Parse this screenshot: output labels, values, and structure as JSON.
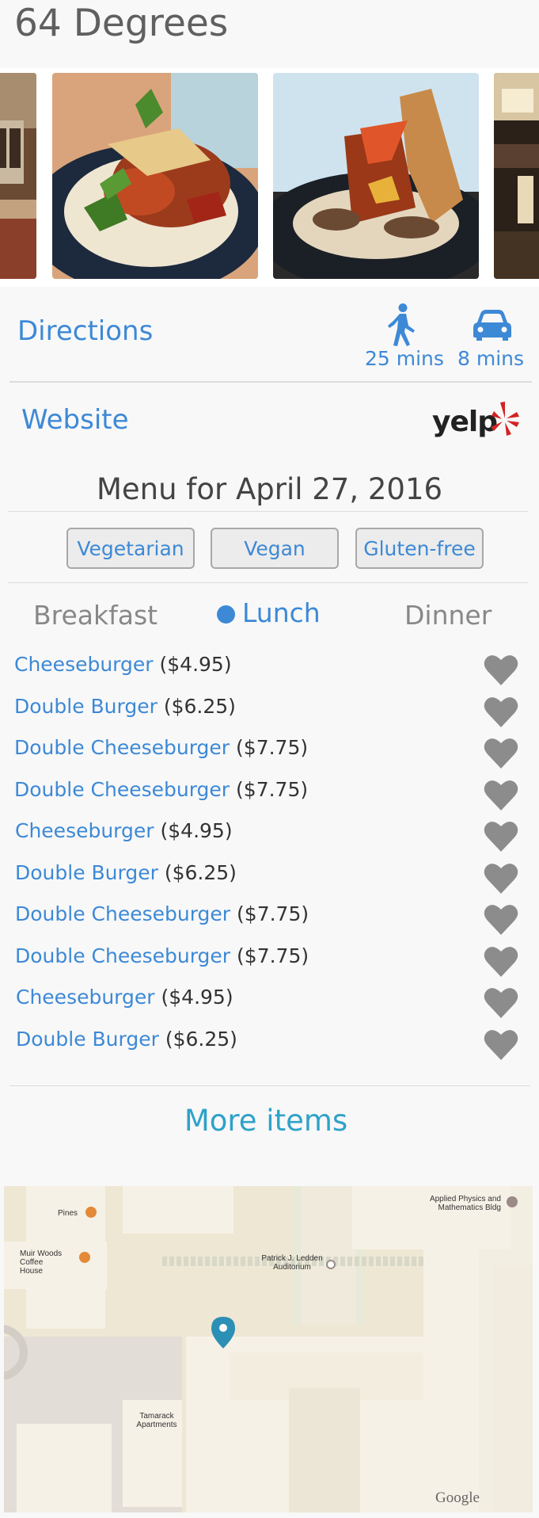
{
  "restaurant": {
    "name": "64 Degrees"
  },
  "photos": [
    {
      "name": "interior-photo-left"
    },
    {
      "name": "food-photo-1"
    },
    {
      "name": "food-photo-2"
    },
    {
      "name": "interior-photo-right"
    }
  ],
  "directions": {
    "label": "Directions",
    "walk": {
      "icon": "walk-icon",
      "time": "25 mins"
    },
    "drive": {
      "icon": "car-icon",
      "time": "8 mins"
    }
  },
  "website": {
    "label": "Website",
    "logo": "yelp",
    "logo_color": "#d32323"
  },
  "menu": {
    "heading": "Menu for April 27, 2016",
    "filters": [
      "Vegetarian",
      "Vegan",
      "Gluten-free"
    ],
    "meals": [
      "Breakfast",
      "Lunch",
      "Dinner"
    ],
    "selected_meal": "Lunch",
    "items": [
      {
        "name": "Cheeseburger",
        "price": "($4.95)"
      },
      {
        "name": "Double Burger",
        "price": "($6.25)"
      },
      {
        "name": "Double Cheeseburger",
        "price": "($7.75)"
      },
      {
        "name": "Double Cheeseburger",
        "price": "($7.75)"
      },
      {
        "name": "Cheeseburger",
        "price": "($4.95)"
      },
      {
        "name": "Double Burger",
        "price": "($6.25)"
      },
      {
        "name": "Double Cheeseburger",
        "price": "($7.75)"
      },
      {
        "name": "Double Cheeseburger",
        "price": "($7.75)"
      },
      {
        "name": "Cheeseburger",
        "price": "($4.95)"
      },
      {
        "name": "Double Burger",
        "price": "($6.25)"
      }
    ],
    "more_label": "More items"
  },
  "map": {
    "labels": {
      "pines": "Pines",
      "muir_woods": "Muir Woods Coffee House",
      "ledden": "Patrick J. Ledden Auditorium",
      "applied_physics": "Applied Physics and Mathematics Bldg",
      "tamarack": "Tamarack Apartments"
    },
    "attribution": "Google"
  },
  "colors": {
    "link": "#3d89d6",
    "more_items": "#2ea2c8",
    "heart": "#8c8c8c",
    "background": "#f8f8f8"
  }
}
